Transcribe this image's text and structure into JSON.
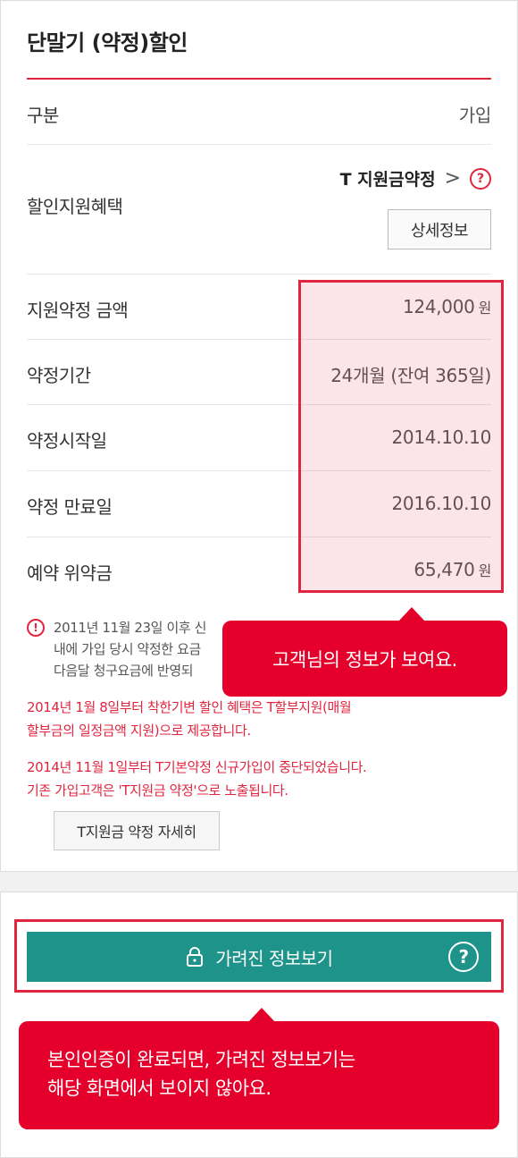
{
  "section": {
    "title": "단말기 (약정)할인"
  },
  "header_row": {
    "label": "구분",
    "value": "가입"
  },
  "benefit": {
    "label": "할인지원혜택",
    "name": "T 지원금약정",
    "chevron": ">",
    "help": "?",
    "detail_button": "상세정보"
  },
  "rows": [
    {
      "label": "지원약정 금액",
      "value": "124,000",
      "unit": "원"
    },
    {
      "label": "약정기간",
      "value": "24개월 (잔여 365일)"
    },
    {
      "label": "약정시작일",
      "value": "2014.10.10"
    },
    {
      "label": "약정 만료일",
      "value": "2016.10.10"
    },
    {
      "label": "예약 위약금",
      "value": "65,470",
      "unit": "원"
    }
  ],
  "notice": {
    "icon": "!",
    "lines": [
      "2011년 11월 23일 이후 신",
      "내에 가입 당시 약정한 요금",
      "다음달 청구요금에 반영되"
    ],
    "red_notes": [
      [
        "2014년 1월 8일부터 착한기변 할인 혜택은 T할부지원(매월",
        "할부금의 일정금액 지원)으로 제공합니다."
      ],
      [
        "2014년 11월 1일부터 T기본약정 신규가입이 중단되었습니다.",
        "기존 가입고객은 'T지원금 약정'으로 노출됩니다."
      ]
    ],
    "detail_button": "T지원금 약정 자세히"
  },
  "tooltip_info": "고객님의 정보가 보여요.",
  "reveal": {
    "label": "가려진 정보보기",
    "help": "?"
  },
  "tooltip_reveal": {
    "line1": "본인인증이 완료되면, 가려진 정보보기는",
    "line2": "해당 화면에서 보이지 않아요."
  },
  "colors": {
    "accent_red": "#e0263f",
    "tooltip_red": "#e4002b",
    "teal": "#1e9389"
  }
}
